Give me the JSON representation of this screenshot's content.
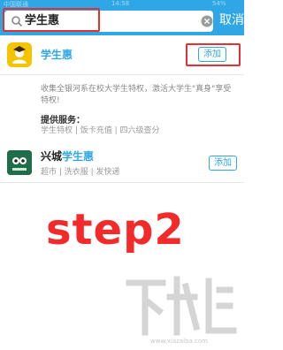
{
  "status_bar": {
    "carrier": "中国联通",
    "time": "14:58",
    "battery": "54%"
  },
  "search": {
    "query": "学生惠",
    "cancel_label": "取消"
  },
  "result_primary": {
    "name": "学生惠",
    "add_label": "添加",
    "description": "收集全银河系在校大学生特权，激活大学生\"真身\"享受特权!",
    "services_title": "提供服务：",
    "services": "学生特权 | 饭卡充值 | 四六级查分"
  },
  "result_secondary": {
    "name_prefix": "兴城",
    "name_highlight": "学生惠",
    "tags": "超市 | 洗衣服 | 发快递",
    "add_label": "添加"
  },
  "annotation": {
    "step_label": "step2"
  },
  "watermark": {
    "brand": "下载吧",
    "caption": "www.xiazaiba.com"
  },
  "colors": {
    "header_blue": "#2fa7e6",
    "accent_red": "#e23131",
    "logo_yellow": "#f5c400"
  }
}
